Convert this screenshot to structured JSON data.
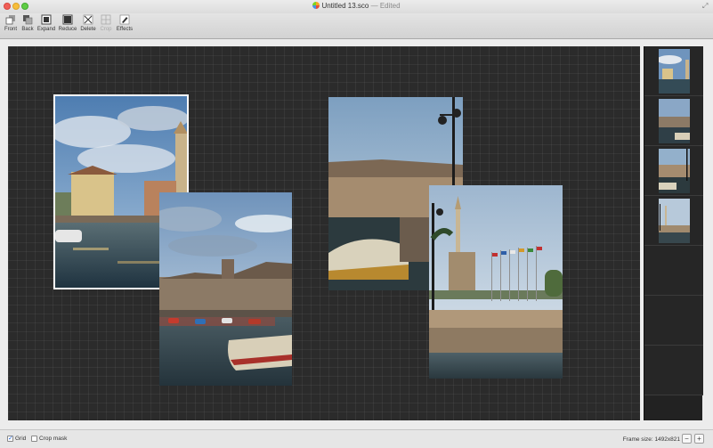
{
  "window": {
    "title": "Untitled 13.sco",
    "title_separator": "—",
    "title_status": "Edited"
  },
  "toolbar": {
    "items": [
      {
        "label": "Front",
        "icon": "front-icon",
        "enabled": true
      },
      {
        "label": "Back",
        "icon": "back-icon",
        "enabled": true
      },
      {
        "label": "Expand",
        "icon": "expand-icon",
        "enabled": true
      },
      {
        "label": "Reduce",
        "icon": "reduce-icon",
        "enabled": true
      },
      {
        "label": "Delete",
        "icon": "delete-icon",
        "enabled": true
      },
      {
        "label": "Crop",
        "icon": "crop-icon",
        "enabled": false
      },
      {
        "label": "Effects",
        "icon": "effects-icon",
        "enabled": true
      }
    ]
  },
  "canvas": {
    "photos": [
      {
        "name": "photo-harbor-bell-tower",
        "scene": "tower",
        "selected": true
      },
      {
        "name": "photo-castle-boats",
        "scene": "castle",
        "selected": false
      },
      {
        "name": "photo-stone-wall-lamp",
        "scene": "wall",
        "selected": false
      },
      {
        "name": "photo-monument-flags",
        "scene": "flags",
        "selected": false
      }
    ]
  },
  "sidebar": {
    "thumbnails": [
      "tower",
      "castle",
      "wall",
      "flags"
    ]
  },
  "status": {
    "grid_label": "Grid",
    "grid_checked": true,
    "crop_mask_label": "Crop mask",
    "crop_mask_checked": false,
    "frame_size_label": "Frame size: 1492x821",
    "zoom_out": "−",
    "zoom_in": "+"
  },
  "colors": {
    "canvas_bg": "#2b2b2b",
    "sidebar_bg": "#222222",
    "sky": "#8fb3d8",
    "water": "#3c5a6a",
    "stone": "#8a735c"
  }
}
